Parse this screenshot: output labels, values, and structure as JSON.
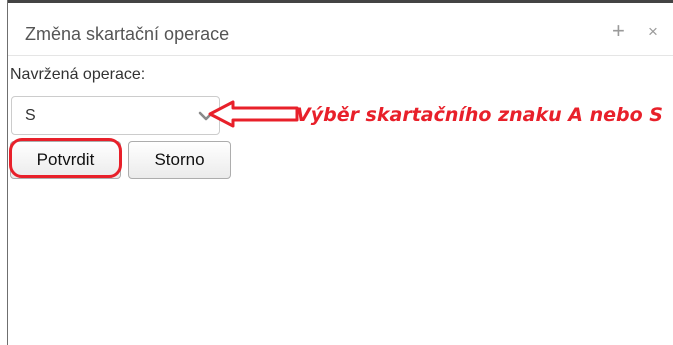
{
  "dialog": {
    "title": "Změna skartační operace",
    "plus_icon": "plus-icon",
    "close_icon": "close-icon",
    "plus_glyph": "+",
    "close_glyph": "×"
  },
  "form": {
    "field_label": "Navržená operace:",
    "selected_value": "S"
  },
  "buttons": {
    "confirm_label": "Potvrdit",
    "cancel_label": "Storno"
  },
  "annotation": {
    "text": "Výběr skartačního znaku A nebo S",
    "color": "#e8202a"
  }
}
